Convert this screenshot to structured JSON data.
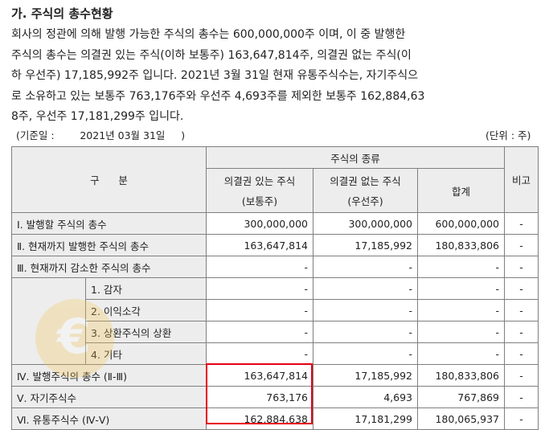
{
  "title": "가. 주식의 총수현황",
  "paragraph": [
    "회사의 정관에 의해 발행 가능한 주식의 총수는 600,000,000주 이며, 이 중 발행한",
    "주식의 총수는 의결권 있는 주식(이하 보통주) 163,647,814주, 의결권 없는 주식(이",
    "하 우선주) 17,185,992주 입니다. 2021년 3월 31일 현재 유통주식수는, 자기주식으",
    "로 소유하고 있는 보통주 763,176주와 우선주 4,693주를 제외한 보통주 162,884,63",
    "8주, 우선주 17,181,299주 입니다."
  ],
  "base_date": "(기준일 :        2021년 03월 31일     )",
  "unit": "(단위 : 주)",
  "table": {
    "header": {
      "category": "구      분",
      "share_type": "주식의 종류",
      "voting_line1": "의결권 있는 주식",
      "voting_line2": "(보통주)",
      "nonvoting_line1": "의결권 없는 주식",
      "nonvoting_line2": "(우선주)",
      "total": "합계",
      "note": "비고"
    },
    "rows": [
      {
        "label": "Ⅰ. 발행할 주식의 총수",
        "voting": "300,000,000",
        "nonvoting": "300,000,000",
        "total": "600,000,000",
        "note": "-"
      },
      {
        "label": "Ⅱ. 현재까지 발행한 주식의 총수",
        "voting": "163,647,814",
        "nonvoting": "17,185,992",
        "total": "180,833,806",
        "note": "-"
      },
      {
        "label": "Ⅲ. 현재까지 감소한 주식의 총수",
        "voting": "-",
        "nonvoting": "-",
        "total": "-",
        "note": "-"
      },
      {
        "label": "1. 감자",
        "voting": "-",
        "nonvoting": "-",
        "total": "-",
        "note": "-"
      },
      {
        "label": "2. 이익소각",
        "voting": "-",
        "nonvoting": "-",
        "total": "-",
        "note": "-"
      },
      {
        "label": "3. 상환주식의 상환",
        "voting": "-",
        "nonvoting": "-",
        "total": "-",
        "note": "-"
      },
      {
        "label": "4. 기타",
        "voting": "-",
        "nonvoting": "-",
        "total": "-",
        "note": "-"
      },
      {
        "label": "Ⅳ. 발행주식의 총수 (Ⅱ-Ⅲ)",
        "voting": "163,647,814",
        "nonvoting": "17,185,992",
        "total": "180,833,806",
        "note": "-"
      },
      {
        "label": "Ⅴ. 자기주식수",
        "voting": "763,176",
        "nonvoting": "4,693",
        "total": "767,869",
        "note": "-"
      },
      {
        "label": "Ⅵ. 유통주식수 (Ⅳ-Ⅴ)",
        "voting": "162,884,638",
        "nonvoting": "17,181,299",
        "total": "180,065,937",
        "note": "-"
      }
    ]
  },
  "highlight_color": "#e60012",
  "header_bg": "#ededed"
}
